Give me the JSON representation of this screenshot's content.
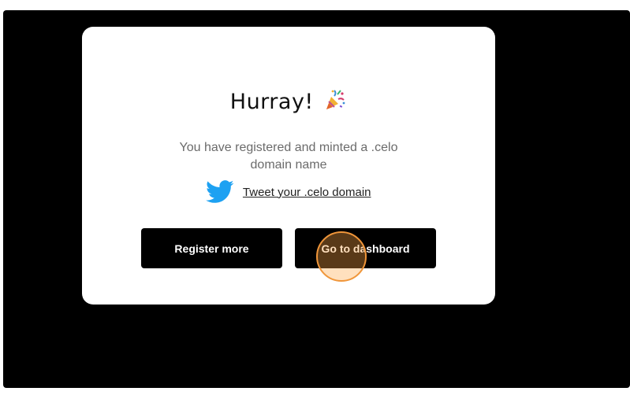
{
  "modal": {
    "title": "Hurray!",
    "title_icon": "party-popper-icon",
    "subtitle": "You have registered and minted a .celo domain name",
    "tweet": {
      "icon": "twitter-icon",
      "icon_color": "#1DA1F2",
      "label": "Tweet your .celo domain"
    },
    "buttons": {
      "register_more": "Register more",
      "go_to_dashboard": "Go to dashboard"
    }
  },
  "colors": {
    "backdrop": "#000000",
    "modal_bg": "#ffffff",
    "button_bg": "#000000",
    "button_text": "#ffffff",
    "click_marker": "#f0963a"
  }
}
